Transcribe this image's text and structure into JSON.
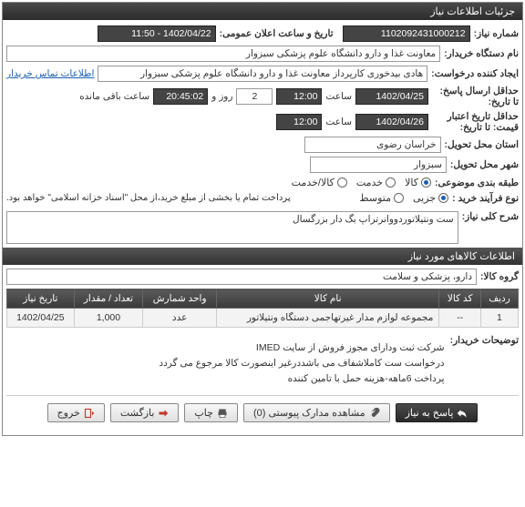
{
  "panel_title": "جزئیات اطلاعات نیاز",
  "fields": {
    "need_number_label": "شماره نیاز:",
    "need_number_value": "1102092431000212",
    "public_datetime_label": "تاریخ و ساعت اعلان عمومی:",
    "public_datetime_value": "1402/04/22 - 11:50",
    "buyer_org_label": "نام دستگاه خریدار:",
    "buyer_org_value": "معاونت غذا و دارو  دانشگاه علوم پزشکی سبزوار",
    "requester_label": "ایجاد کننده درخواست:",
    "requester_value": "هادی بیدخوری کارپرداز معاونت غذا و دارو  دانشگاه علوم پزشکی سبزوار",
    "contact_link": "اطلاعات تماس خریدار",
    "deadline_label": "حداقل ارسال پاسخ: تا تاریخ:",
    "deadline_date": "1402/04/25",
    "hour_label": "ساعت",
    "deadline_hour": "12:00",
    "day_label": "روز و",
    "days_value": "2",
    "remaining_value": "20:45:02",
    "remaining_label": "ساعت باقی مانده",
    "validity_label": "حداقل تاریخ اعتبار قیمت: تا تاریخ:",
    "validity_date": "1402/04/26",
    "validity_hour": "12:00",
    "province_label": "استان محل تحویل:",
    "province_value": "خراسان رضوی",
    "city_label": "شهر محل تحویل:",
    "city_value": "سبزوار",
    "category_label": "طبقه بندی موضوعی:",
    "cat_goods": "کالا",
    "cat_service": "خدمت",
    "cat_both": "کالا/خدمت",
    "purchase_type_label": "نوع فرآیند خرید :",
    "pt_small": "جزیی",
    "pt_medium": "متوسط",
    "payment_note": "پرداخت تمام یا بخشی از مبلغ خرید،از محل \"اسناد خزانه اسلامی\" خواهد بود.",
    "desc_label": "شرح کلی نیاز:",
    "desc_value": "ست ونتیلاتوردووانرتراپ بگ دار بزرگسال",
    "items_header": "اطلاعات کالاهای مورد نیاز",
    "goods_group_label": "گروه کالا:",
    "goods_group_value": "دارو، پزشکی و سلامت",
    "table": {
      "headers": [
        "ردیف",
        "کد کالا",
        "نام کالا",
        "واحد شمارش",
        "تعداد / مقدار",
        "تاریخ نیاز"
      ],
      "row": [
        "1",
        "--",
        "مجموعه لوازم مدار غیرتهاجمی دستگاه ونتیلاتور",
        "عدد",
        "1,000",
        "1402/04/25"
      ]
    },
    "buyer_notes_label": "توضیحات خریدار:",
    "buyer_notes_lines": [
      "شرکت ثبت ودارای مجوز فروش از سایت IMED",
      "درخواست ست کاملاشفاف می باشددرغیر اینصورت کالا مرجوع می گردد",
      "پرداخت 6ماهه-هزینه حمل با تامین کننده"
    ]
  },
  "footer": {
    "respond": "پاسخ به نیاز",
    "attachments": "مشاهده مدارک پیوستی (0)",
    "print": "چاپ",
    "back": "بازگشت",
    "exit": "خروج"
  }
}
